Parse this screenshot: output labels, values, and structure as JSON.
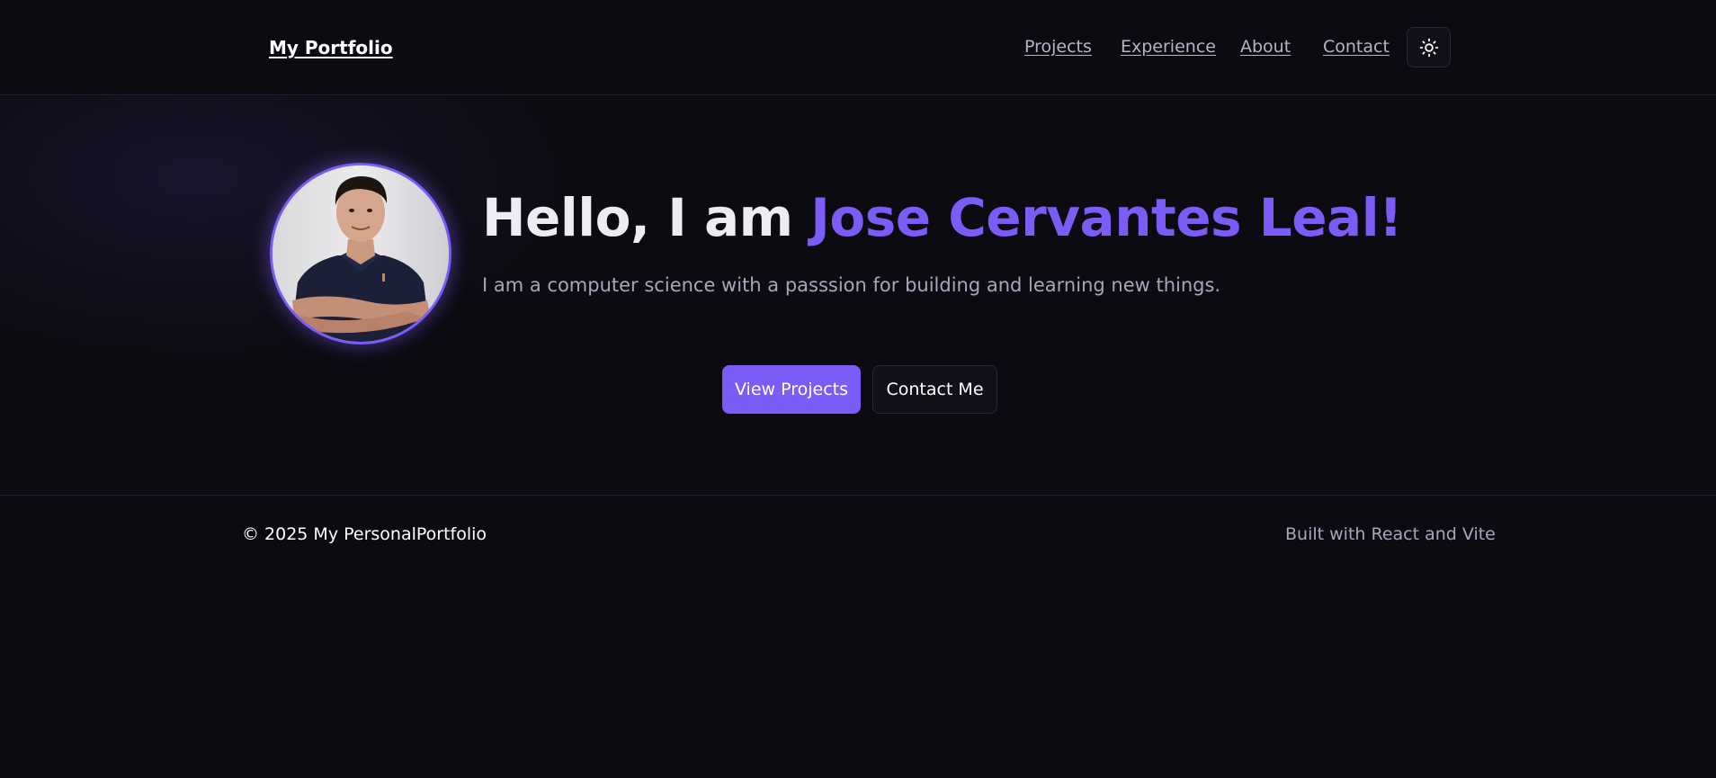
{
  "header": {
    "brand": "My Portfolio",
    "nav": [
      {
        "label": "Projects"
      },
      {
        "label": "Experience"
      },
      {
        "label": "About"
      },
      {
        "label": "Contact"
      }
    ],
    "theme_toggle_icon": "sun-icon"
  },
  "hero": {
    "title_prefix": "Hello, I am ",
    "title_name": "Jose Cervantes Leal!",
    "subtitle": "I am a computer science with a passsion for building and learning new things.",
    "primary_button": "View Projects",
    "secondary_button": "Contact Me",
    "accent_color": "#7c5cf6"
  },
  "footer": {
    "copyright": "© 2025 My PersonalPortfolio",
    "built_with": "Built with React and Vite"
  },
  "colors": {
    "background": "#0c0b11",
    "accent": "#7c5cf6",
    "muted_text": "#a4a8bc"
  }
}
